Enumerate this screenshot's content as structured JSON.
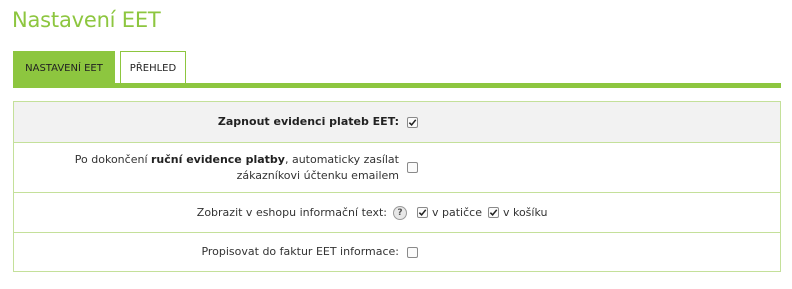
{
  "page": {
    "title": "Nastavení EET"
  },
  "tabs": [
    {
      "label": "NASTAVENÍ EET",
      "active": true
    },
    {
      "label": "PŘEHLED",
      "active": false
    }
  ],
  "colors": {
    "accent": "#8dc63f",
    "border": "#c4e09a"
  },
  "settings": {
    "enable_eet": {
      "label": "Zapnout evidenci plateb EET:",
      "checked": true
    },
    "manual_receipt": {
      "label_before": "Po dokončení ",
      "label_bold": "ruční evidence platby",
      "label_after": ", automaticky zasílat zákazníkovi účtenku emailem",
      "checked": false
    },
    "show_info": {
      "label": "Zobrazit v eshopu informační text:",
      "help_icon": "question-mark-icon",
      "help_glyph": "?",
      "footer": {
        "label": "v patičce",
        "checked": true
      },
      "cart": {
        "label": "v košíku",
        "checked": true
      }
    },
    "invoice_info": {
      "label": "Propisovat do faktur EET informace:",
      "checked": false
    }
  }
}
